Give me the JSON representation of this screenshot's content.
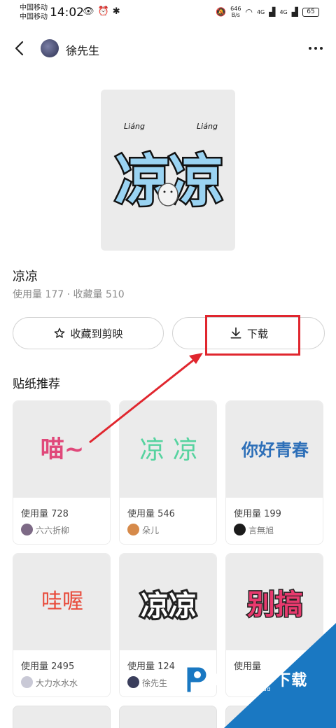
{
  "status": {
    "carrier1": "中国移动",
    "carrier2": "中国移动",
    "time": "14:02",
    "net_speed_value": "646",
    "net_speed_unit": "B/s",
    "signal1": "4G",
    "signal2": "4G",
    "battery": "65"
  },
  "nav": {
    "author": "徐先生"
  },
  "sticker": {
    "title": "凉凉",
    "stats": "使用量 177 · 收藏量 510",
    "art_text": "凉凉",
    "pinyin": "Liáng"
  },
  "actions": {
    "favorite_label": "收藏到剪映",
    "download_label": "下载"
  },
  "section": {
    "title": "贴纸推荐"
  },
  "cards": [
    {
      "usage": "使用量 728",
      "user": "六六折柳",
      "art": "喵~",
      "color": "#e0487a"
    },
    {
      "usage": "使用量 546",
      "user": "朵儿",
      "art": "凉 凉",
      "color": "#57d3a0"
    },
    {
      "usage": "使用量 199",
      "user": "言無旭",
      "art": "你好青春",
      "color": "#2d6fb8"
    },
    {
      "usage": "使用量 2495",
      "user": "大力水水水",
      "art": "哇喔",
      "color": "#e84a3a"
    },
    {
      "usage": "使用量 124",
      "user": "徐先生",
      "art": "凉凉",
      "color": "#222222"
    },
    {
      "usage": "使用量",
      "user": "",
      "art": "别搞",
      "color": "#e83a6e"
    }
  ],
  "watermark": {
    "brand": "PCPOP下载",
    "sub": "PCPOP Download"
  },
  "colors": {
    "accent_red": "#e0262e",
    "watermark_blue": "#1a78c2"
  }
}
